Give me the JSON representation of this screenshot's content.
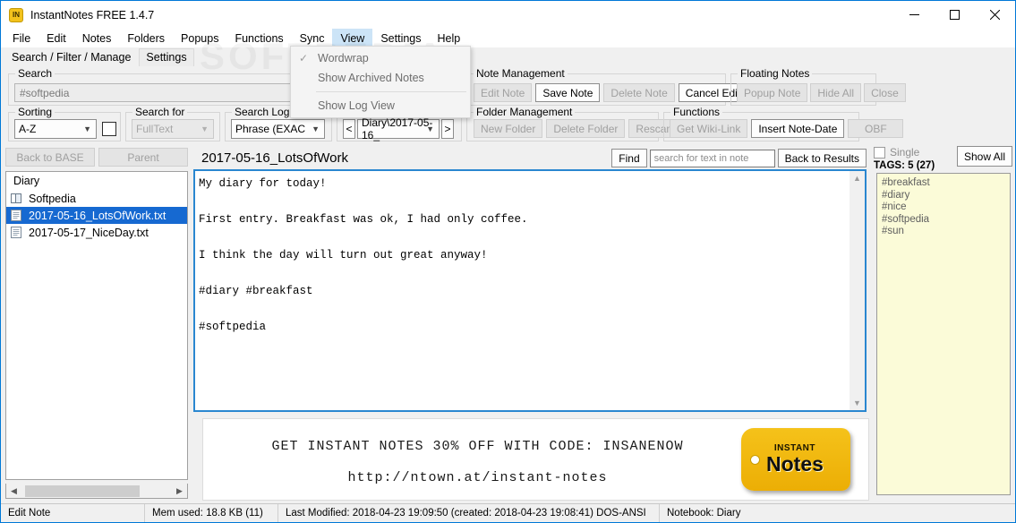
{
  "window": {
    "title": "InstantNotes FREE 1.4.7",
    "app_icon": "IN",
    "minimize": "minimize-icon",
    "maximize": "maximize-icon",
    "close": "close-icon"
  },
  "watermark": "SOFTPEDIA",
  "menubar": {
    "items": [
      {
        "label": "File"
      },
      {
        "label": "Edit"
      },
      {
        "label": "Notes"
      },
      {
        "label": "Folders"
      },
      {
        "label": "Popups"
      },
      {
        "label": "Functions"
      },
      {
        "label": "Sync"
      },
      {
        "label": "View"
      },
      {
        "label": "Settings"
      },
      {
        "label": "Help"
      }
    ],
    "open_menu": "View"
  },
  "view_menu": {
    "items": [
      {
        "label": "Wordwrap",
        "checked": true
      },
      {
        "label": "Show Archived Notes",
        "checked": false
      },
      {
        "label": "Show Log View",
        "checked": false
      }
    ]
  },
  "tabs": [
    {
      "label": "Search / Filter / Manage",
      "active": true
    },
    {
      "label": "Settings",
      "active": false
    }
  ],
  "search_group": {
    "legend": "Search",
    "value": "#softpedia"
  },
  "sorting_group": {
    "legend": "Sorting",
    "value": "A-Z"
  },
  "search_for_group": {
    "legend": "Search for",
    "value": "FullText"
  },
  "search_logic_group": {
    "legend": "Search Logic",
    "value": "Phrase (EXAC"
  },
  "folder_nav": {
    "prev": "<",
    "path": "Diary\\2017-05-16_",
    "next": ">"
  },
  "note_management": {
    "legend": "Note Management",
    "buttons": [
      {
        "label": "Edit Note",
        "enabled": false
      },
      {
        "label": "Save Note",
        "enabled": true
      },
      {
        "label": "Delete Note",
        "enabled": false
      },
      {
        "label": "Cancel Edit",
        "enabled": true
      }
    ]
  },
  "folder_management": {
    "legend": "Folder Management",
    "buttons": [
      {
        "label": "New Folder",
        "enabled": false
      },
      {
        "label": "Delete Folder",
        "enabled": false
      },
      {
        "label": "Rescan Folders",
        "enabled": false
      }
    ]
  },
  "floating_notes": {
    "legend": "Floating Notes",
    "buttons": [
      {
        "label": "Popup Note",
        "enabled": false
      },
      {
        "label": "Hide All",
        "enabled": false
      },
      {
        "label": "Close",
        "enabled": false
      }
    ]
  },
  "functions_group": {
    "legend": "Functions",
    "buttons": [
      {
        "label": "Get Wiki-Link",
        "enabled": false
      },
      {
        "label": "Insert Note-Date",
        "enabled": true
      },
      {
        "label": "OBF",
        "enabled": false
      }
    ]
  },
  "left_panel": {
    "back_to_base": "Back to BASE",
    "parent": "Parent",
    "header": "Diary",
    "items": [
      {
        "label": "Softpedia",
        "icon": "folder-icon",
        "selected": false
      },
      {
        "label": "2017-05-16_LotsOfWork.txt",
        "icon": "document-icon",
        "selected": true
      },
      {
        "label": "2017-05-17_NiceDay.txt",
        "icon": "document-icon",
        "selected": false
      }
    ]
  },
  "note": {
    "title": "2017-05-16_LotsOfWork",
    "find_label": "Find",
    "find_placeholder": "search for text in note",
    "back_to_results": "Back to Results",
    "body": "My diary for today!\n\nFirst entry. Breakfast was ok, I had only coffee.\n\nI think the day will turn out great anyway!\n\n#diary #breakfast\n\n#softpedia"
  },
  "banner": {
    "line1": "GET  INSTANT  NOTES  30%  OFF  WITH  CODE:  INSANENOW",
    "line2": "http://ntown.at/instant-notes",
    "logo_top": "INSTANT",
    "logo_bottom": "Notes"
  },
  "tags_panel": {
    "single_label": "Single",
    "count_label": "TAGS: 5 (27)",
    "show_all": "Show All",
    "tags": [
      "#breakfast",
      "#diary",
      "#nice",
      "#softpedia",
      "#sun"
    ]
  },
  "statusbar": {
    "mode": "Edit Note",
    "memory": "Mem used: 18.8 KB (11)",
    "modified": "Last Modified: 2018-04-23 19:09:50 (created: 2018-04-23 19:08:41) DOS-ANSI",
    "notebook": "Notebook: Diary"
  },
  "colors": {
    "accent": "#0078d7",
    "selection": "#1669d1",
    "editor_border": "#2a87d0",
    "tag_bg": "#fbfbd8",
    "logo_yellow": "#f5c21a"
  }
}
